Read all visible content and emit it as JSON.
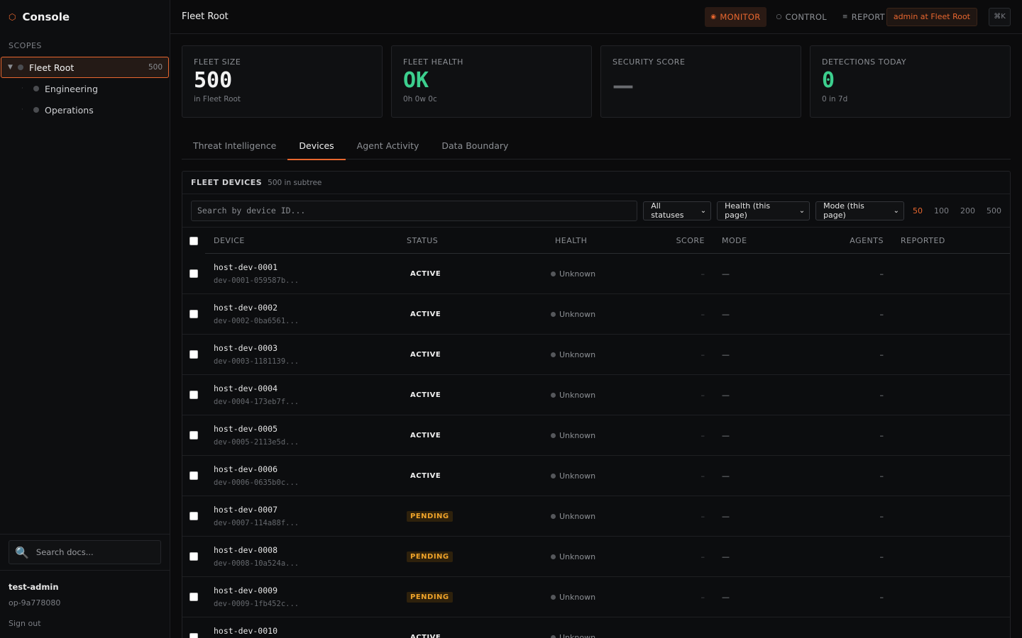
{
  "app": {
    "brand": "Console",
    "brand_icon": "⬡"
  },
  "sidebar": {
    "scopes_label": "SCOPES",
    "scopes": [
      {
        "label": "Fleet Root",
        "count": "500",
        "active": true
      },
      {
        "label": "Engineering"
      },
      {
        "label": "Operations"
      }
    ],
    "doc_search_placeholder": "Search docs...",
    "user": {
      "name": "test-admin",
      "op": "op-9a778080",
      "signout": "Sign out"
    }
  },
  "header": {
    "title": "Fleet Root",
    "modes": [
      {
        "label": "MONITOR",
        "active": true
      },
      {
        "label": "CONTROL"
      },
      {
        "label": "REPORT"
      }
    ],
    "admin_pill": "admin at Fleet Root",
    "shortcut": "⌘K"
  },
  "cards": [
    {
      "label": "FLEET SIZE",
      "value": "500",
      "sub": "in Fleet Root"
    },
    {
      "label": "FLEET HEALTH",
      "value": "OK",
      "sub": "0h 0w 0c"
    },
    {
      "label": "SECURITY SCORE",
      "value": "—",
      "sub": ""
    },
    {
      "label": "DETECTIONS TODAY",
      "value": "0",
      "sub": "0 in 7d"
    }
  ],
  "tabs": [
    {
      "label": "Threat Intelligence"
    },
    {
      "label": "Devices",
      "active": true
    },
    {
      "label": "Agent Activity"
    },
    {
      "label": "Data Boundary"
    }
  ],
  "devices": {
    "title": "FLEET DEVICES",
    "subtitle": "500 in subtree",
    "search_placeholder": "Search by device ID...",
    "filters": [
      "All statuses",
      "Health (this page)",
      "Mode (this page)"
    ],
    "page_sizes": [
      "50",
      "100",
      "200",
      "500"
    ],
    "page_size_selected": "50",
    "columns": {
      "device": "DEVICE",
      "status": "STATUS",
      "health": "HEALTH",
      "score": "SCORE",
      "mode": "MODE",
      "agents": "AGENTS",
      "reported": "REPORTED"
    },
    "rows": [
      {
        "name": "host-dev-0001",
        "id": "dev-0001-059587b...",
        "status": "ACTIVE",
        "health": "Unknown",
        "score": "–",
        "mode": "—",
        "agents": "–"
      },
      {
        "name": "host-dev-0002",
        "id": "dev-0002-0ba6561...",
        "status": "ACTIVE",
        "health": "Unknown",
        "score": "–",
        "mode": "—",
        "agents": "–"
      },
      {
        "name": "host-dev-0003",
        "id": "dev-0003-1181139...",
        "status": "ACTIVE",
        "health": "Unknown",
        "score": "–",
        "mode": "—",
        "agents": "–"
      },
      {
        "name": "host-dev-0004",
        "id": "dev-0004-173eb7f...",
        "status": "ACTIVE",
        "health": "Unknown",
        "score": "–",
        "mode": "—",
        "agents": "–"
      },
      {
        "name": "host-dev-0005",
        "id": "dev-0005-2113e5d...",
        "status": "ACTIVE",
        "health": "Unknown",
        "score": "–",
        "mode": "—",
        "agents": "–"
      },
      {
        "name": "host-dev-0006",
        "id": "dev-0006-0635b0c...",
        "status": "ACTIVE",
        "health": "Unknown",
        "score": "–",
        "mode": "—",
        "agents": "–"
      },
      {
        "name": "host-dev-0007",
        "id": "dev-0007-114a88f...",
        "status": "PENDING",
        "health": "Unknown",
        "score": "–",
        "mode": "—",
        "agents": "–"
      },
      {
        "name": "host-dev-0008",
        "id": "dev-0008-10a524a...",
        "status": "PENDING",
        "health": "Unknown",
        "score": "–",
        "mode": "—",
        "agents": "–"
      },
      {
        "name": "host-dev-0009",
        "id": "dev-0009-1fb452c...",
        "status": "PENDING",
        "health": "Unknown",
        "score": "–",
        "mode": "—",
        "agents": "–"
      },
      {
        "name": "host-dev-0010",
        "id": "",
        "status": "ACTIVE",
        "health": "Unknown",
        "score": "",
        "mode": "",
        "agents": ""
      }
    ]
  },
  "colors": {
    "accent": "#e8672f",
    "ok": "#3ccf8e",
    "pending": "#f0a42a"
  }
}
